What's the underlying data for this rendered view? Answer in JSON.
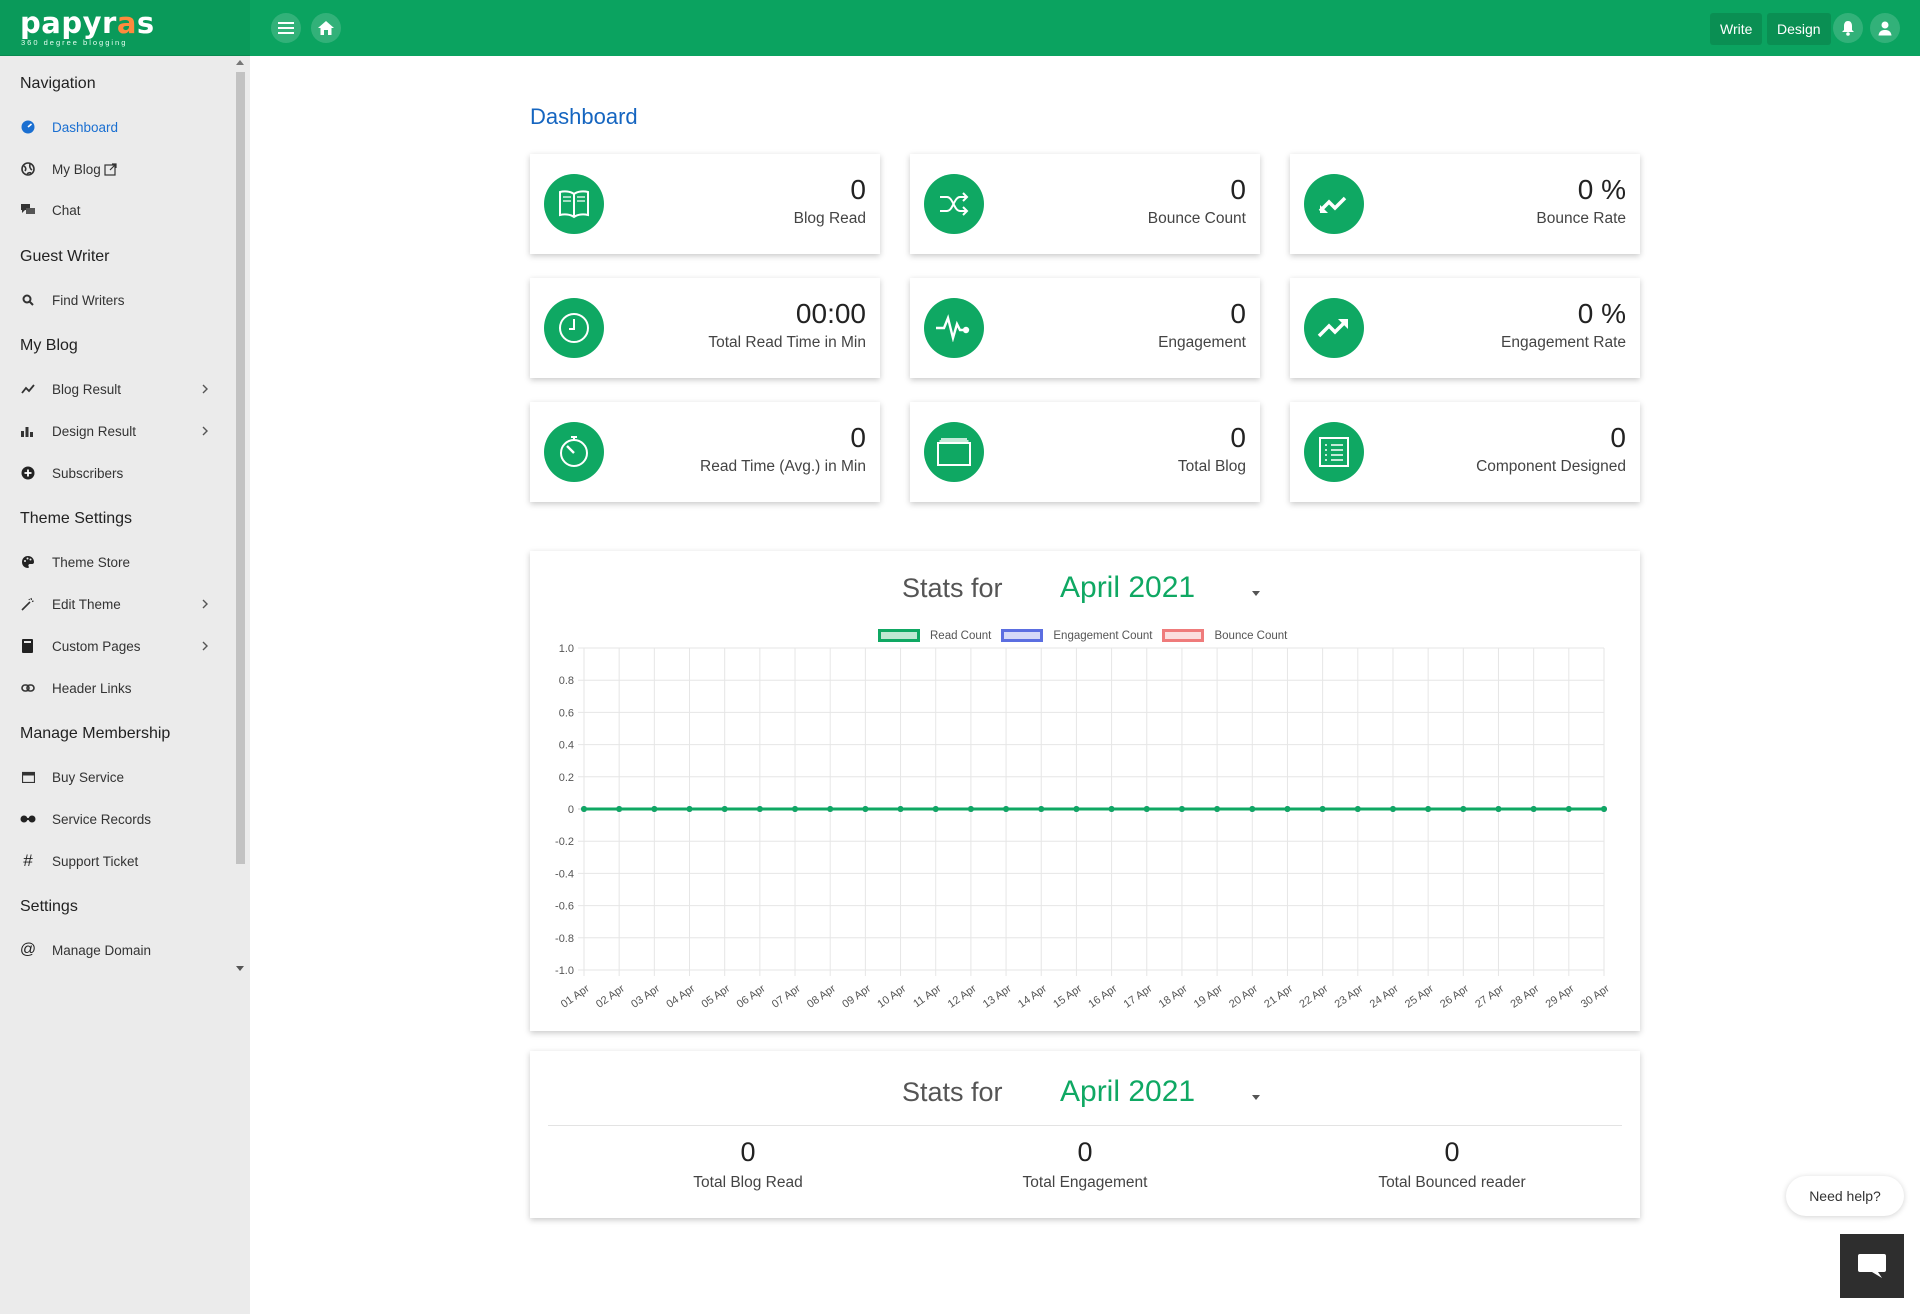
{
  "brand": {
    "name_part1": "pap",
    "name_part2": "yr",
    "name_accent": "a",
    "name_part3": "s",
    "tagline": "360 degree blogging"
  },
  "topbar": {
    "write_label": "Write",
    "design_label": "Design"
  },
  "sidebar": {
    "sections": [
      {
        "title": "Navigation",
        "items": [
          {
            "label": "Dashboard",
            "icon": "dashboard-icon",
            "active": true
          },
          {
            "label": "My Blog",
            "icon": "globe-icon",
            "external": true
          },
          {
            "label": "Chat",
            "icon": "chat-icon"
          }
        ]
      },
      {
        "title": "Guest Writer",
        "items": [
          {
            "label": "Find Writers",
            "icon": "search-icon"
          }
        ]
      },
      {
        "title": "My Blog",
        "items": [
          {
            "label": "Blog Result",
            "icon": "trend-icon",
            "submenu": true
          },
          {
            "label": "Design Result",
            "icon": "bar-chart-icon",
            "submenu": true
          },
          {
            "label": "Subscribers",
            "icon": "plus-circle-icon"
          }
        ]
      },
      {
        "title": "Theme Settings",
        "items": [
          {
            "label": "Theme Store",
            "icon": "palette-icon"
          },
          {
            "label": "Edit Theme",
            "icon": "magic-wand-icon",
            "submenu": true
          },
          {
            "label": "Custom Pages",
            "icon": "book-icon",
            "submenu": true
          },
          {
            "label": "Header Links",
            "icon": "link-icon"
          }
        ]
      },
      {
        "title": "Manage Membership",
        "items": [
          {
            "label": "Buy Service",
            "icon": "calendar-icon"
          },
          {
            "label": "Service Records",
            "icon": "records-icon"
          },
          {
            "label": "Support Ticket",
            "icon": "hash-icon"
          }
        ]
      },
      {
        "title": "Settings",
        "items": [
          {
            "label": "Manage Domain",
            "icon": "at-icon"
          }
        ]
      }
    ]
  },
  "main": {
    "title": "Dashboard",
    "cards": [
      {
        "value": "0",
        "label": "Blog Read",
        "icon": "open-book-icon"
      },
      {
        "value": "0",
        "label": "Bounce Count",
        "icon": "shuffle-icon"
      },
      {
        "value": "0 %",
        "label": "Bounce Rate",
        "icon": "trend-down-icon"
      },
      {
        "value": "00:00",
        "label": "Total Read Time in Min",
        "icon": "clock-icon"
      },
      {
        "value": "0",
        "label": "Engagement",
        "icon": "pulse-icon"
      },
      {
        "value": "0 %",
        "label": "Engagement Rate",
        "icon": "trend-up-icon"
      },
      {
        "value": "0",
        "label": "Read Time (Avg.) in Min",
        "icon": "timer-icon"
      },
      {
        "value": "0",
        "label": "Total Blog",
        "icon": "folder-icon"
      },
      {
        "value": "0",
        "label": "Component Designed",
        "icon": "list-icon"
      }
    ],
    "chart_panel": {
      "stats_for": "Stats for",
      "month": "April 2021"
    },
    "summary_panel": {
      "stats_for": "Stats for",
      "month": "April 2021",
      "items": [
        {
          "value": "0",
          "label": "Total Blog Read"
        },
        {
          "value": "0",
          "label": "Total Engagement"
        },
        {
          "value": "0",
          "label": "Total Bounced reader"
        }
      ]
    }
  },
  "chat": {
    "need_help": "Need help?"
  },
  "colors": {
    "brand": "#0ba360",
    "accent": "#0fa863",
    "read": "#0fa863",
    "engagement": "#5b6ee1",
    "bounce": "#ef7b7b"
  },
  "chart_data": {
    "type": "line",
    "categories": [
      "01 Apr",
      "02 Apr",
      "03 Apr",
      "04 Apr",
      "05 Apr",
      "06 Apr",
      "07 Apr",
      "08 Apr",
      "09 Apr",
      "10 Apr",
      "11 Apr",
      "12 Apr",
      "13 Apr",
      "14 Apr",
      "15 Apr",
      "16 Apr",
      "17 Apr",
      "18 Apr",
      "19 Apr",
      "20 Apr",
      "21 Apr",
      "22 Apr",
      "23 Apr",
      "24 Apr",
      "25 Apr",
      "26 Apr",
      "27 Apr",
      "28 Apr",
      "29 Apr",
      "30 Apr"
    ],
    "series": [
      {
        "name": "Read Count",
        "values": [
          0,
          0,
          0,
          0,
          0,
          0,
          0,
          0,
          0,
          0,
          0,
          0,
          0,
          0,
          0,
          0,
          0,
          0,
          0,
          0,
          0,
          0,
          0,
          0,
          0,
          0,
          0,
          0,
          0,
          0
        ]
      },
      {
        "name": "Engagement Count",
        "values": [
          0,
          0,
          0,
          0,
          0,
          0,
          0,
          0,
          0,
          0,
          0,
          0,
          0,
          0,
          0,
          0,
          0,
          0,
          0,
          0,
          0,
          0,
          0,
          0,
          0,
          0,
          0,
          0,
          0,
          0
        ]
      },
      {
        "name": "Bounce Count",
        "values": [
          0,
          0,
          0,
          0,
          0,
          0,
          0,
          0,
          0,
          0,
          0,
          0,
          0,
          0,
          0,
          0,
          0,
          0,
          0,
          0,
          0,
          0,
          0,
          0,
          0,
          0,
          0,
          0,
          0,
          0
        ]
      }
    ],
    "yticks": [
      "1.0",
      "0.8",
      "0.6",
      "0.4",
      "0.2",
      "0",
      "-0.2",
      "-0.4",
      "-0.6",
      "-0.8",
      "-1.0"
    ],
    "ylim": [
      -1.0,
      1.0
    ],
    "grid": true,
    "legend": "top-center"
  }
}
